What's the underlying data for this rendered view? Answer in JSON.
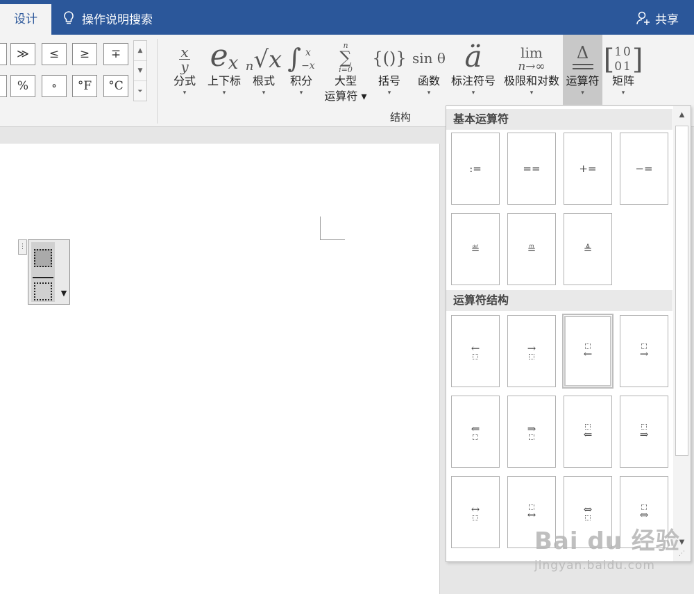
{
  "topbar": {
    "tab_design": "设计",
    "tell_me": "操作说明搜索",
    "share": "共享"
  },
  "symbols": [
    "≫",
    "≤",
    "≥",
    "∓",
    "%",
    "∘",
    "°F",
    "°C"
  ],
  "structures": [
    {
      "id": "fraction",
      "icon": "x/y",
      "label": "分式"
    },
    {
      "id": "script",
      "icon": "eˣ",
      "label": "上下标"
    },
    {
      "id": "radical",
      "icon": "ⁿ√x",
      "label": "根式"
    },
    {
      "id": "integral",
      "icon": "∫",
      "label": "积分"
    },
    {
      "id": "large-operator",
      "icon": "∑",
      "label": "大型",
      "label2": "运算符"
    },
    {
      "id": "bracket",
      "icon": "{()}",
      "label": "括号"
    },
    {
      "id": "function",
      "icon": "sin θ",
      "label": "函数"
    },
    {
      "id": "accent",
      "icon": "ä",
      "label": "标注符号"
    },
    {
      "id": "limit-log",
      "icon": "lim n→∞",
      "label": "极限和对数"
    },
    {
      "id": "operator",
      "icon": "Δ",
      "label": "运算符"
    },
    {
      "id": "matrix",
      "icon": "[1 0; 0 1]",
      "label": "矩阵"
    }
  ],
  "ribbon_group_label": "结构",
  "panel": {
    "section1_title": "基本运算符",
    "section2_title": "运算符结构",
    "basic_ops": [
      ":=",
      "==",
      "+=",
      "−=",
      "≝",
      "≞",
      "≜"
    ]
  },
  "watermark": {
    "logo": "Bai du 经验",
    "url": "jingyan.baidu.com"
  },
  "colors": {
    "title_bar": "#2b579a",
    "ribbon_bg": "#f3f3f3",
    "active_button": "#c8c8c8"
  }
}
